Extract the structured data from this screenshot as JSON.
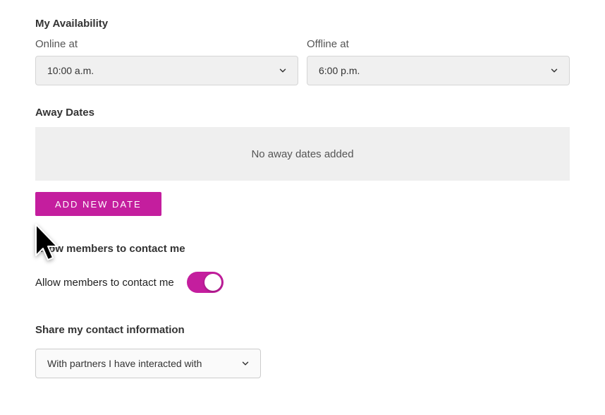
{
  "availability": {
    "heading": "My Availability",
    "online_label": "Online at",
    "online_value": "10:00 a.m.",
    "offline_label": "Offline at",
    "offline_value": "6:00 p.m."
  },
  "away": {
    "heading": "Away Dates",
    "empty_text": "No away dates added",
    "add_button": "ADD NEW DATE"
  },
  "contact": {
    "heading": "Allow members to contact me",
    "toggle_label": "Allow members to contact me"
  },
  "share": {
    "heading": "Share my contact information",
    "value": "With partners I have interacted with"
  }
}
